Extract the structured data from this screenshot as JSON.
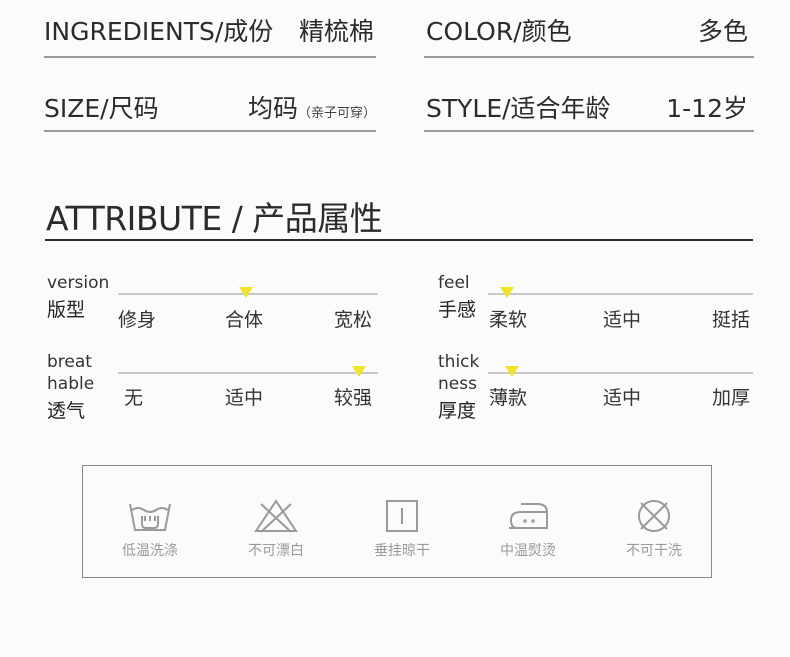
{
  "specs": {
    "ingredients": {
      "label": "INGREDIENTS/成份",
      "value": "精梳棉"
    },
    "color": {
      "label": "COLOR/颜色",
      "value": "多色"
    },
    "size": {
      "label": "SIZE/尺码",
      "value": "均码",
      "note": "（亲子可穿）"
    },
    "style": {
      "label": "STYLE/适合年龄",
      "value": "1-12岁"
    }
  },
  "attribute_title": "ATTRIBUTE / 产品属性",
  "attributes": {
    "version": {
      "en": "version",
      "cn": "版型",
      "options": [
        "修身",
        "合体",
        "宽松"
      ],
      "selected_fraction": 0.5
    },
    "feel": {
      "en": "feel",
      "cn": "手感",
      "options": [
        "柔软",
        "适中",
        "挺括"
      ],
      "selected_fraction": 0.05
    },
    "breathable": {
      "en1": "breat",
      "en2": "hable",
      "cn": "透气",
      "options": [
        "无",
        "适中",
        "较强"
      ],
      "selected_fraction": 0.95
    },
    "thickness": {
      "en1": "thick",
      "en2": "ness",
      "cn": "厚度",
      "options": [
        "薄款",
        "适中",
        "加厚"
      ],
      "selected_fraction": 0.07
    }
  },
  "care": [
    {
      "icon": "low-temp-wash-icon",
      "label": "低温洗涤"
    },
    {
      "icon": "no-bleach-icon",
      "label": "不可漂白"
    },
    {
      "icon": "hang-dry-icon",
      "label": "垂挂晾干"
    },
    {
      "icon": "medium-iron-icon",
      "label": "中温熨烫"
    },
    {
      "icon": "no-dry-clean-icon",
      "label": "不可干洗"
    }
  ],
  "colors": {
    "marker": "#f1e32a",
    "text": "#2b2b2b",
    "care_gray": "#9a9a9a"
  }
}
